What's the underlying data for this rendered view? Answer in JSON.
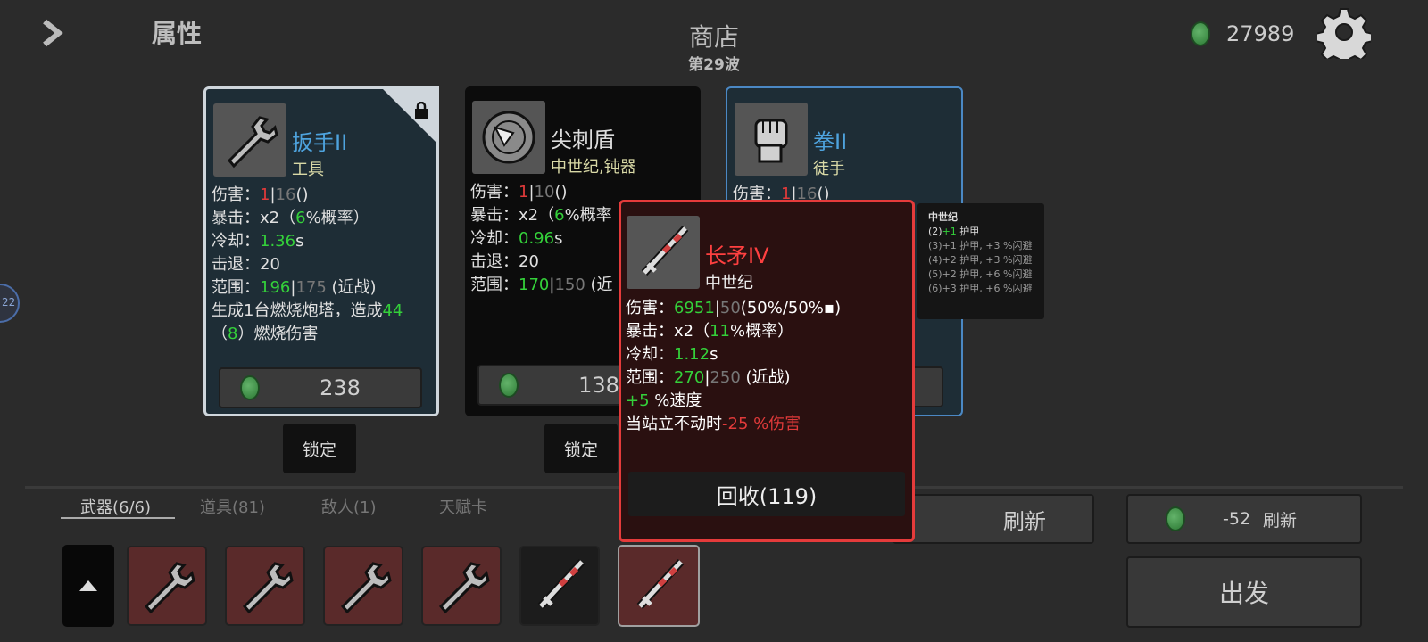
{
  "header": {
    "stats_label": "属性",
    "shop_title": "商店",
    "wave_label": "第29波",
    "coins": "27989"
  },
  "cards": [
    {
      "name": "扳手II",
      "type": "工具",
      "lines": {
        "damage_label": "伤害：",
        "damage_val": "1",
        "damage_sep": "|",
        "damage_base": "16",
        "damage_tail": "()",
        "crit_label": "暴击：",
        "crit_mult": "x2（",
        "crit_pct": "6",
        "crit_tail": "%概率）",
        "cooldown_label": "冷却：",
        "cooldown_val": "1.36",
        "cooldown_unit": "s",
        "knockback": "击退：20",
        "range_label": "范围：",
        "range_val": "196",
        "range_sep": "|",
        "range_base": "175",
        "range_tail": " (近战)",
        "effect_1a": "生成1台燃烧炮塔，造成",
        "effect_1b": "44",
        "effect_2a": "（",
        "effect_2b": "8",
        "effect_2c": "）燃烧伤害"
      },
      "price": "238",
      "lock_label": "锁定"
    },
    {
      "name": "尖刺盾",
      "type": "中世纪,钝器",
      "lines": {
        "damage_label": "伤害：",
        "damage_val": "1",
        "damage_sep": "|",
        "damage_base": "10",
        "damage_tail": "()",
        "crit_label": "暴击：",
        "crit_mult": "x2（",
        "crit_pct": "6",
        "crit_tail": "%概率",
        "cooldown_label": "冷却：",
        "cooldown_val": "0.96",
        "cooldown_unit": "s",
        "knockback": "击退：20",
        "range_label": "范围：",
        "range_val": "170",
        "range_sep": "|",
        "range_base": "150",
        "range_tail": " (近"
      },
      "price": "138",
      "lock_label": "锁定"
    },
    {
      "name": "拳II",
      "type": "徒手",
      "lines": {
        "damage_label": "伤害：",
        "damage_val": "1",
        "damage_sep": "|",
        "damage_base": "16",
        "damage_tail": "()"
      }
    }
  ],
  "popup": {
    "name": "长矛IV",
    "type": "中世纪",
    "damage_label": "伤害：",
    "damage_val": "6951",
    "damage_sep": "|",
    "damage_base": "50",
    "damage_a": "(50%",
    "damage_b": "50%",
    "damage_c": ")",
    "crit_label": "暴击：",
    "crit_mult": "x2（",
    "crit_pct": "11",
    "crit_tail": "%概率）",
    "cooldown_label": "冷却：",
    "cooldown_val": "1.12",
    "cooldown_unit": "s",
    "range_label": "范围：",
    "range_val": "270",
    "range_sep": "|",
    "range_base": "250",
    "range_tail": " (近战)",
    "speed_val": "+5",
    "speed_tail": " %速度",
    "stand_a": "当站立不动时",
    "stand_b": "-25 %伤害",
    "recycle_label": "回收(119)"
  },
  "set_tooltip": {
    "title": "中世纪",
    "line1_a": "(2)",
    "line1_b": "+1",
    "line1_c": " 护甲",
    "line2": "(3)+1 护甲, +3 %闪避",
    "line3": "(4)+2 护甲, +3 %闪避",
    "line4": "(5)+2 护甲, +6 %闪避",
    "line5": "(6)+3 护甲, +6 %闪避"
  },
  "tabs": [
    "武器(6/6)",
    "道具(81)",
    "敌人(1)",
    "天赋卡"
  ],
  "side_badge": "22",
  "refresh": {
    "label": "刷新",
    "cost": "-52",
    "cost_label": "刷新"
  },
  "go_label": "出发",
  "inventory": [
    {
      "icon": "wrench-icon"
    },
    {
      "icon": "wrench-icon"
    },
    {
      "icon": "wrench-icon"
    },
    {
      "icon": "wrench-icon"
    },
    {
      "icon": "spear-icon"
    },
    {
      "icon": "spear-icon"
    }
  ],
  "colors": {
    "card_border": "#cfd6dc",
    "card_blue": "#4b88c4",
    "popup_red": "#e53b3b",
    "name_blue": "#4ea3de",
    "name_red": "#ff4040"
  }
}
